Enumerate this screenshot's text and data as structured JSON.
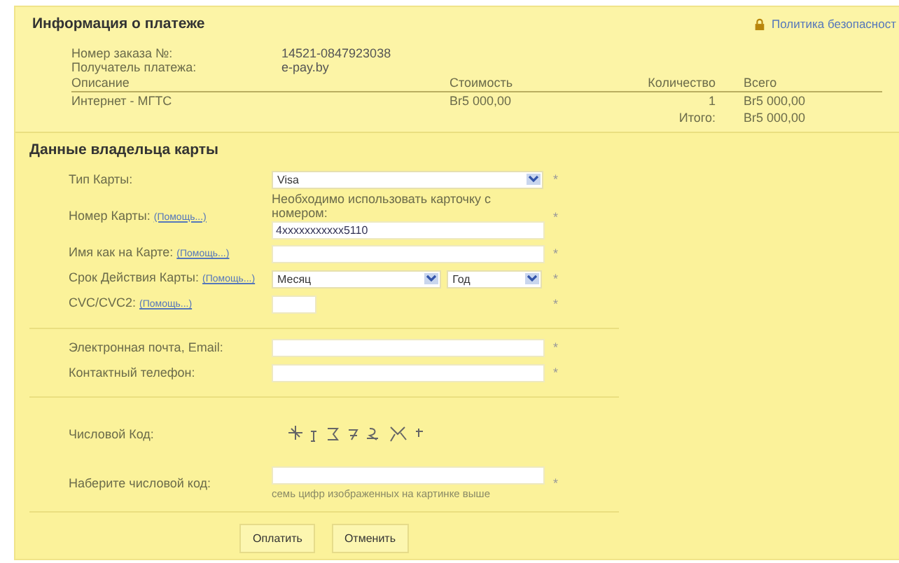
{
  "payment_info": {
    "title": "Информация о платеже",
    "policy_link": "Политика безопасност",
    "details": [
      {
        "label": "Номер заказа №:",
        "value": "14521-0847923038"
      },
      {
        "label": "Получатель платежа:",
        "value": "e-pay.by"
      }
    ],
    "table": {
      "columns": [
        "Описание",
        "Стоимость",
        "Количество",
        "Всего"
      ],
      "rows": [
        [
          "Интернет - МГТС",
          "Br5 000,00",
          "1",
          "Br5 000,00"
        ]
      ],
      "total_label": "Итого:",
      "total_value": "Br5 000,00"
    }
  },
  "card_holder": {
    "title": "Данные владельца карты",
    "groups": [
      {
        "rows": [
          {
            "kind": "select",
            "label": "Тип Карты:",
            "value": "Visa",
            "required": "*"
          },
          {
            "kind": "text",
            "label": "Номер Карты:",
            "help": "(Помощь...)",
            "note": "Необходимо использовать карточку с номером:",
            "value": "4xxxxxxxxxxx5110",
            "required": "*"
          },
          {
            "kind": "text",
            "label": "Имя как на Карте:",
            "help": "(Помощь...)",
            "required": "*"
          },
          {
            "kind": "expiry",
            "label": "Срок Действия Карты:",
            "help": "(Помощь...)",
            "month": "Месяц",
            "year": "Год",
            "required": "*"
          },
          {
            "kind": "short",
            "label": "CVC/CVC2:",
            "help": "(Помощь...)",
            "required": "*"
          }
        ]
      },
      {
        "rows": [
          {
            "kind": "text",
            "label": "Электронная почта, Email:",
            "required": "*"
          },
          {
            "kind": "text",
            "label": "Контактный телефон:",
            "required": "*"
          }
        ]
      },
      {
        "rows": [
          {
            "kind": "captcha",
            "label": "Числовой Код:"
          },
          {
            "kind": "text",
            "label": "Наберите числовой код:",
            "hint": "семь цифр изображенных на картинке выше",
            "required": "*"
          }
        ]
      }
    ],
    "buttons": [
      "Оплатить",
      "Отменить"
    ]
  }
}
